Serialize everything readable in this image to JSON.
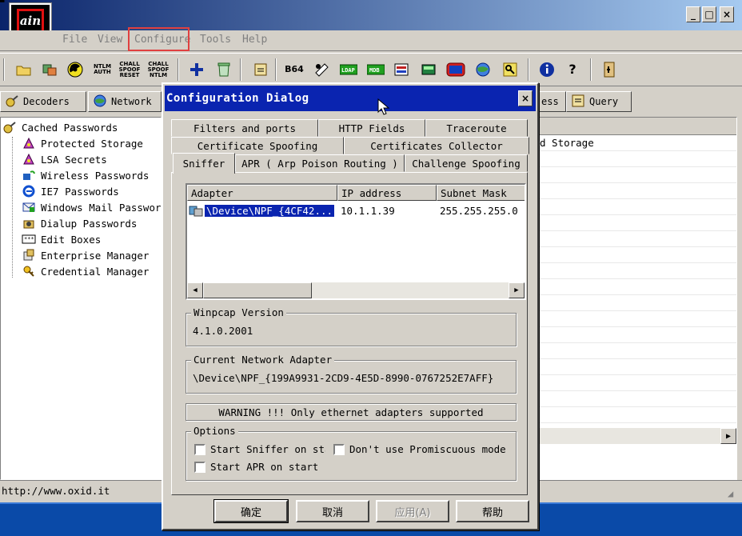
{
  "window": {
    "icon_text": "ain",
    "controls": {
      "minimize": "_",
      "maximize": "□",
      "close": "×"
    }
  },
  "menu": {
    "file": "File",
    "view": "View",
    "configure": "Configure",
    "tools": "Tools",
    "help": "Help"
  },
  "toolbar": {
    "ntlm_auth": "NTLM AUTH",
    "chall_spoof_reset": "CHALL SPOOF RESET",
    "chall_spoof_ntlm": "CHALL SPOOF NTLM",
    "b64": "B64",
    "ldap_label": "LDAP",
    "mdb_label": "MDB"
  },
  "main_tabs": {
    "decoders": "Decoders",
    "network": "Network",
    "ess": "ess",
    "query": "Query"
  },
  "tree": {
    "root": "Cached Passwords",
    "items": [
      "Protected Storage",
      "LSA Secrets",
      "Wireless Passwords",
      "IE7 Passwords",
      "Windows Mail Passwor",
      "Dialup Passwords",
      "Edit Boxes",
      "Enterprise Manager",
      "Credential Manager"
    ]
  },
  "right_panel": {
    "first_row": "d Storage"
  },
  "status": {
    "url": "http://www.oxid.it"
  },
  "dialog": {
    "title": "Configuration Dialog",
    "close": "×",
    "tabs_row1": [
      "Filters and ports",
      "HTTP Fields",
      "Traceroute"
    ],
    "tabs_row2": [
      "Certificate Spoofing",
      "Certificates Collector"
    ],
    "tabs_row3": [
      "Sniffer",
      "APR ( Arp Poison Routing )",
      "Challenge Spoofing"
    ],
    "active_tab": "Sniffer",
    "adapter_list": {
      "columns": [
        "Adapter",
        "IP address",
        "Subnet Mask"
      ],
      "rows": [
        {
          "adapter": "\\Device\\NPF_{4CF42...",
          "ip": "10.1.1.39",
          "mask": "255.255.255.0"
        }
      ]
    },
    "winpcap": {
      "legend": "Winpcap Version",
      "value": "4.1.0.2001"
    },
    "current_adapter": {
      "legend": "Current Network Adapter",
      "value": "\\Device\\NPF_{199A9931-2CD9-4E5D-8990-0767252E7AFF}"
    },
    "warning": "WARNING !!! Only ethernet adapters supported",
    "options": {
      "legend": "Options",
      "start_sniffer": "Start Sniffer on startup",
      "dont_promiscuous": "Don't use Promiscuous mode",
      "start_apr": "Start APR on startup"
    },
    "buttons": {
      "ok": "确定",
      "cancel": "取消",
      "apply": "应用(A)",
      "help": "帮助"
    }
  },
  "colors": {
    "title_bar": "#0a24b0",
    "selection": "#0a24b0",
    "face": "#d4d0c8",
    "highlight_box": "#e04040",
    "taskbar": "#0a4aa8"
  }
}
